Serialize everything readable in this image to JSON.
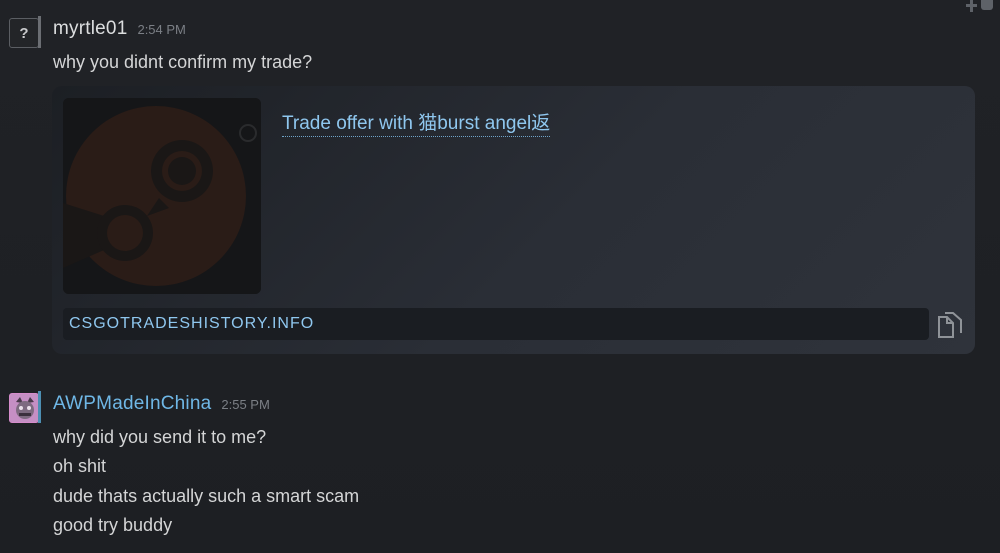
{
  "messages": [
    {
      "author": "myrtle01",
      "time": "2:54 PM",
      "avatar_glyph": "?",
      "lines": [
        "why you didnt confirm my trade?"
      ],
      "embed": {
        "title": "Trade offer with 猫burst angel返",
        "url": "CSGOTRADESHISTORY.INFO",
        "thumbnail_icon": "steam-logo-icon"
      }
    },
    {
      "author": "AWPMadeInChina",
      "time": "2:55 PM",
      "lines": [
        "why did you send it to me?",
        "oh shit",
        "dude thats actually such a smart scam",
        "good try buddy"
      ]
    }
  ],
  "colors": {
    "background": "#1e2024",
    "link": "#8fc7ef",
    "author_blue": "#6fb7e6",
    "text": "#d4d5d6",
    "timestamp": "#7b7f85"
  }
}
